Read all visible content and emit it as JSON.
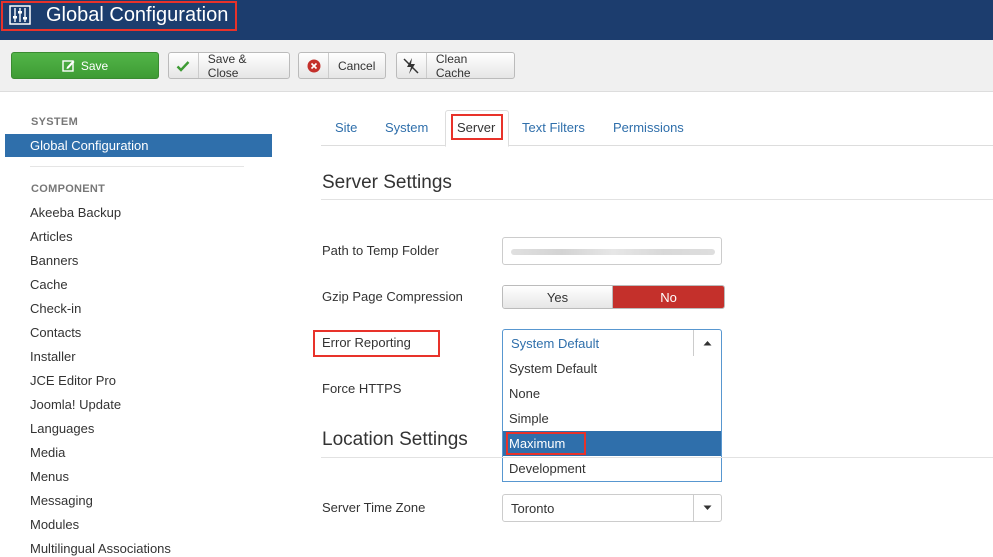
{
  "header": {
    "title": "Global Configuration",
    "icon": "equalizer-icon",
    "bg_color": "#1c3d6e"
  },
  "toolbar": {
    "save_label": "Save",
    "save_close_label": "Save & Close",
    "cancel_label": "Cancel",
    "clean_cache_label": "Clean Cache"
  },
  "sidebar": {
    "system_heading": "SYSTEM",
    "active_item": "Global Configuration",
    "component_heading": "COMPONENT",
    "items": [
      "Akeeba Backup",
      "Articles",
      "Banners",
      "Cache",
      "Check-in",
      "Contacts",
      "Installer",
      "JCE Editor Pro",
      "Joomla! Update",
      "Languages",
      "Media",
      "Menus",
      "Messaging",
      "Modules",
      "Multilingual Associations"
    ]
  },
  "tabs": {
    "items": [
      "Site",
      "System",
      "Server",
      "Text Filters",
      "Permissions"
    ],
    "active": "Server"
  },
  "server_settings": {
    "title": "Server Settings",
    "temp_folder_label": "Path to Temp Folder",
    "gzip_label": "Gzip Page Compression",
    "gzip_yes": "Yes",
    "gzip_no": "No",
    "gzip_selected": "No",
    "error_reporting_label": "Error Reporting",
    "error_reporting_value": "System Default",
    "error_reporting_options": [
      "System Default",
      "None",
      "Simple",
      "Maximum",
      "Development"
    ],
    "error_reporting_highlighted": "Maximum",
    "force_https_label": "Force HTTPS"
  },
  "location_settings": {
    "title": "Location Settings",
    "timezone_label": "Server Time Zone",
    "timezone_value": "Toronto"
  },
  "colors": {
    "accent_blue": "#2f6fab",
    "save_green": "#46a83d",
    "no_red": "#c4302b",
    "annotation_red": "#e8322a"
  }
}
